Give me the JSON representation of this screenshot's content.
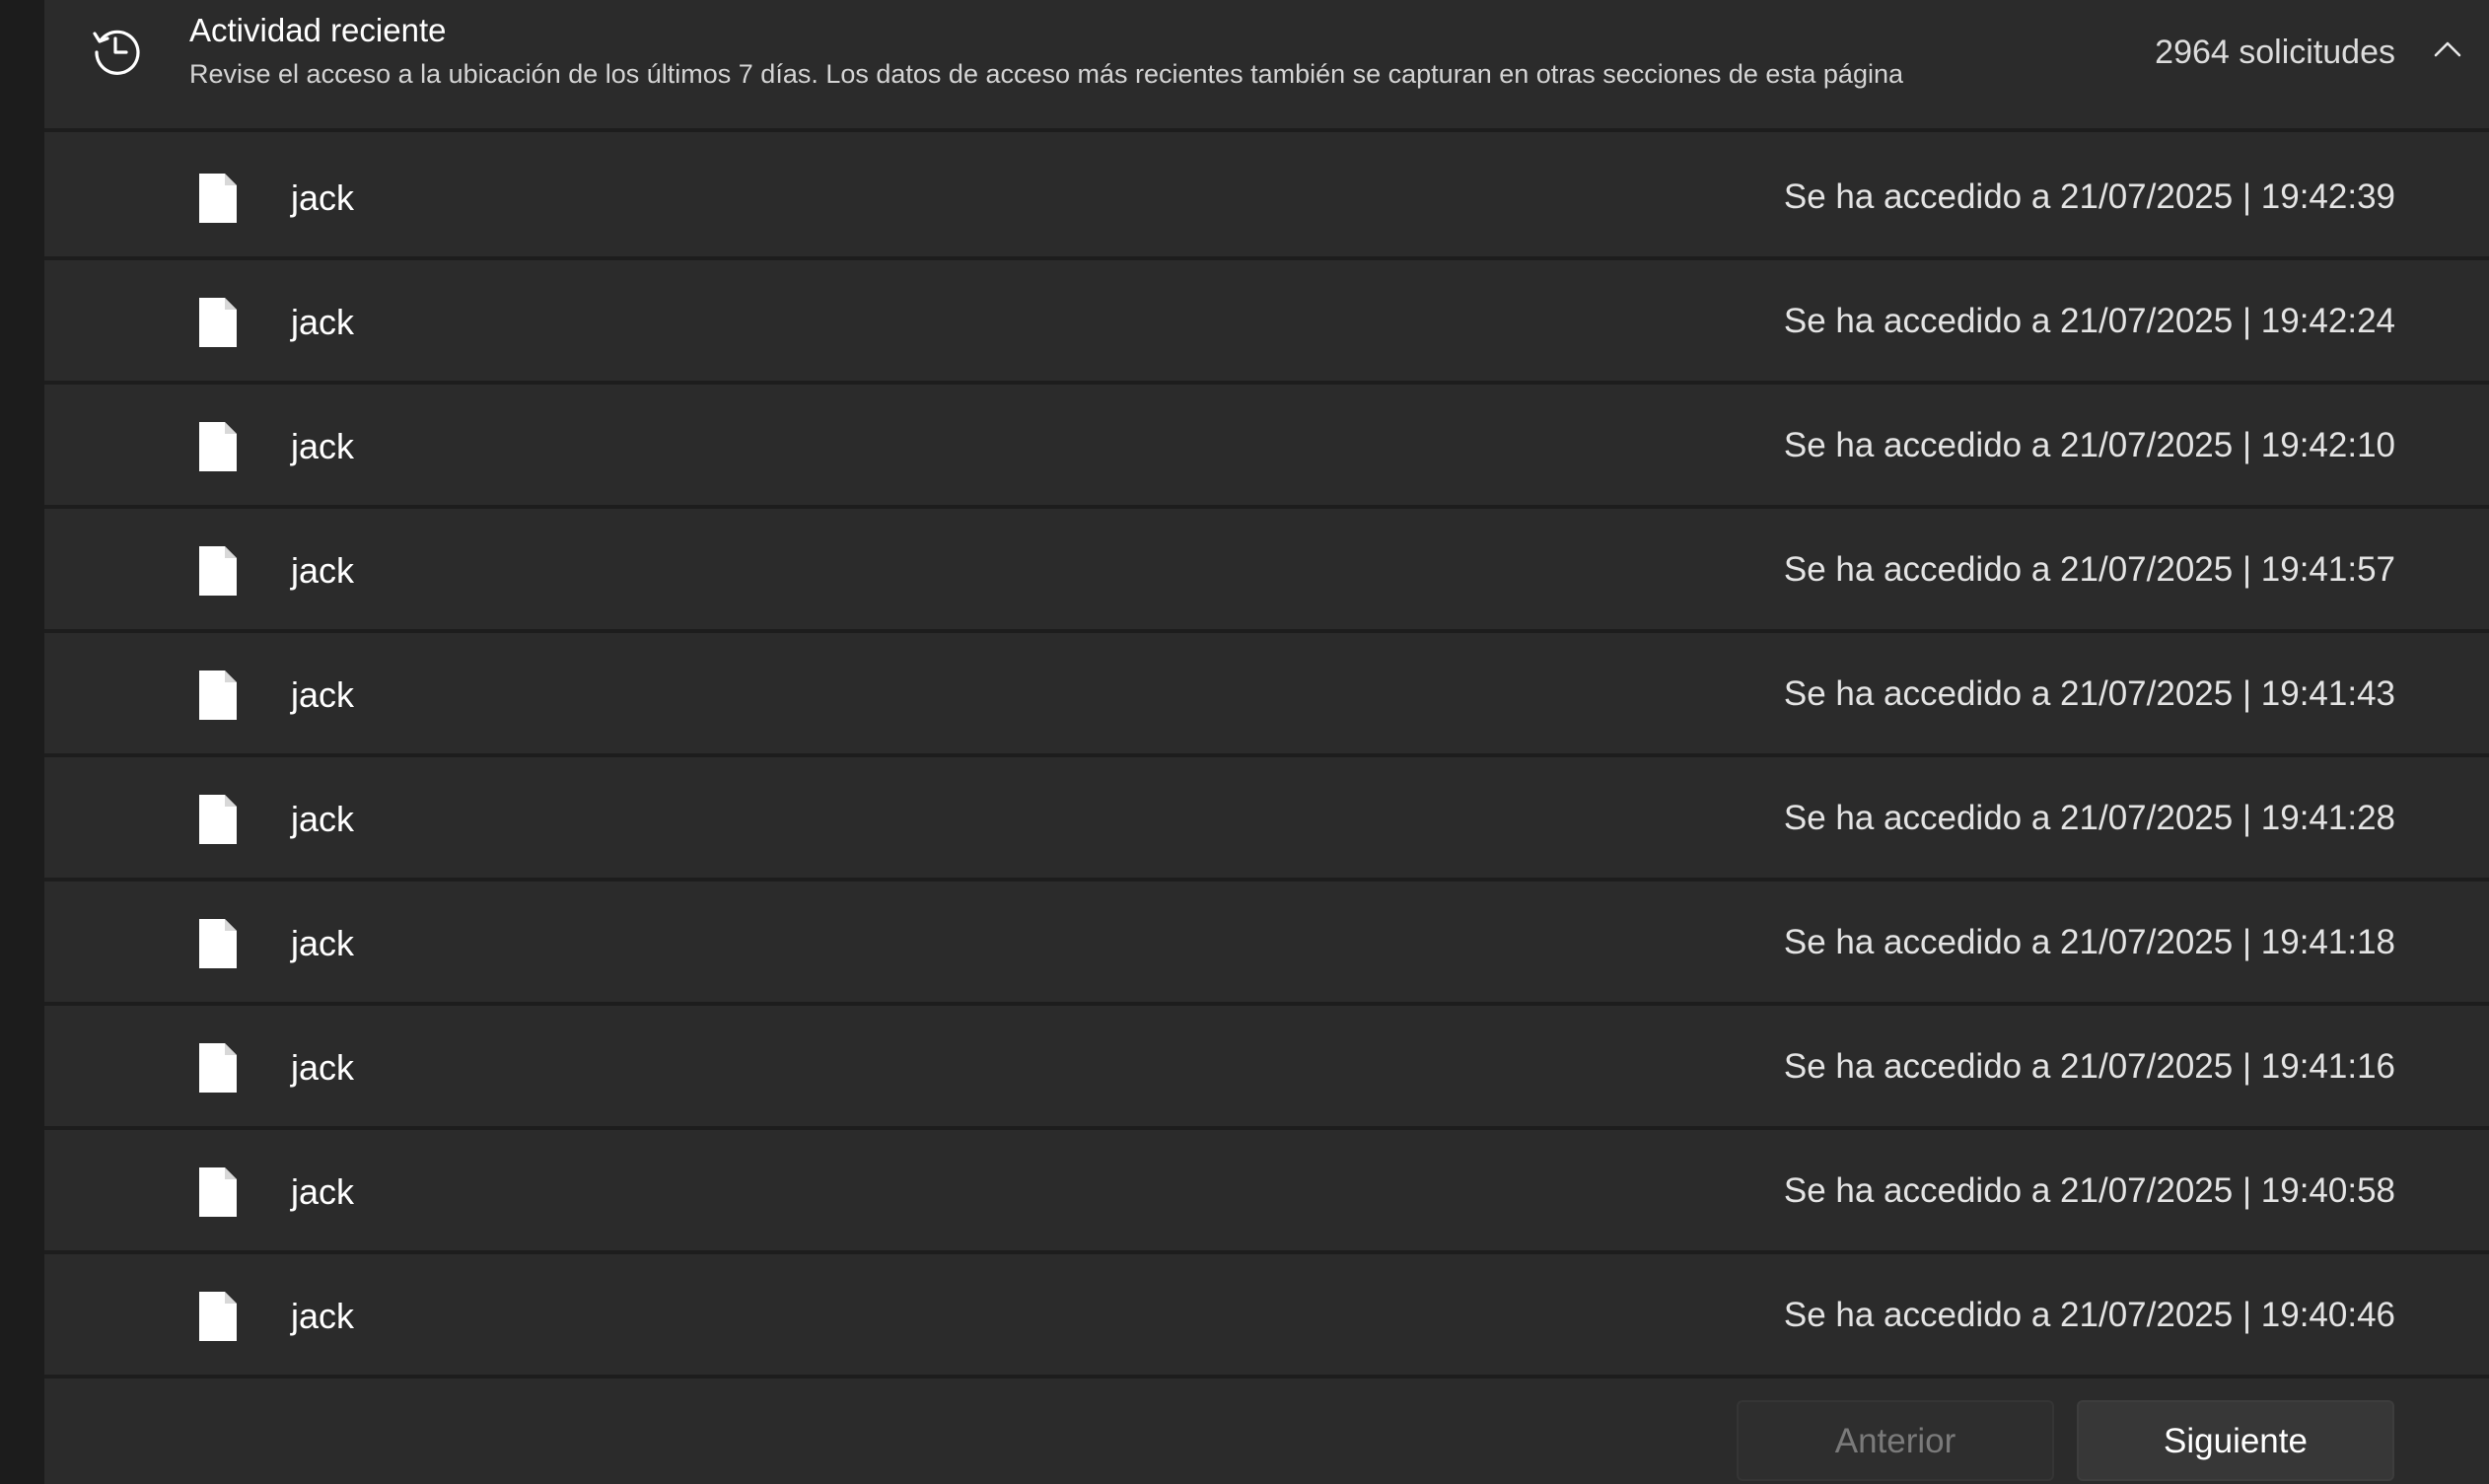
{
  "header": {
    "icon": "history-clock-icon",
    "title": "Actividad reciente",
    "subtitle": "Revise el acceso a la ubicación de los últimos 7 días. Los datos de acceso más recientes también se capturan en otras secciones de esta página",
    "count": "2964 solicitudes",
    "collapse_icon": "chevron-up-icon"
  },
  "rows": [
    {
      "icon": "file-icon",
      "name": "jack",
      "time": "Se ha accedido a 21/07/2025 |  19:42:39"
    },
    {
      "icon": "file-icon",
      "name": "jack",
      "time": "Se ha accedido a 21/07/2025 |  19:42:24"
    },
    {
      "icon": "file-icon",
      "name": "jack",
      "time": "Se ha accedido a 21/07/2025 |  19:42:10"
    },
    {
      "icon": "file-icon",
      "name": "jack",
      "time": "Se ha accedido a 21/07/2025 |  19:41:57"
    },
    {
      "icon": "file-icon",
      "name": "jack",
      "time": "Se ha accedido a 21/07/2025 |  19:41:43"
    },
    {
      "icon": "file-icon",
      "name": "jack",
      "time": "Se ha accedido a 21/07/2025 |  19:41:28"
    },
    {
      "icon": "file-icon",
      "name": "jack",
      "time": "Se ha accedido a 21/07/2025 |  19:41:18"
    },
    {
      "icon": "file-icon",
      "name": "jack",
      "time": "Se ha accedido a 21/07/2025 |  19:41:16"
    },
    {
      "icon": "file-icon",
      "name": "jack",
      "time": "Se ha accedido a 21/07/2025 |  19:40:58"
    },
    {
      "icon": "file-icon",
      "name": "jack",
      "time": "Se ha accedido a 21/07/2025 |  19:40:46"
    }
  ],
  "pagination": {
    "prev_label": "Anterior",
    "prev_enabled": false,
    "next_label": "Siguiente",
    "next_enabled": true
  },
  "colors": {
    "panel_bg": "#2b2b2b",
    "divider": "#1d1d1d",
    "text_primary": "#ffffff",
    "text_secondary": "#d4d4d4",
    "disabled_text": "#7a7a7a"
  }
}
